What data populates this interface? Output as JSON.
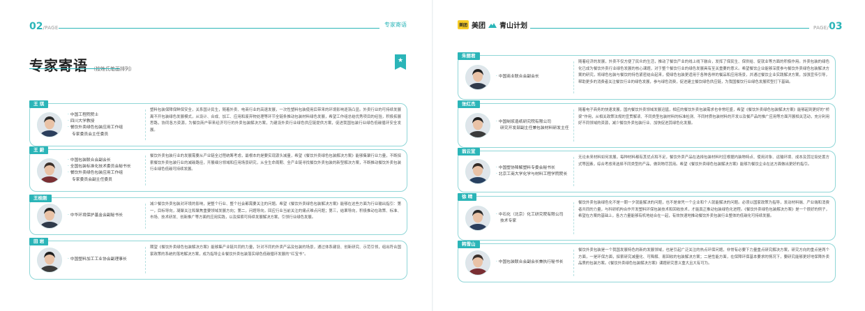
{
  "left_page": {
    "page_num": "02",
    "page_suffix": "/PAGE",
    "section": "专家寄语",
    "title": "专家寄语",
    "subtitle": "（按姓氏笔画排列）",
    "bookmark_icon": "star-icon",
    "experts": [
      {
        "name": "王 琪",
        "roles": [
          "中国工程院院士",
          "四川大学教授",
          "餐饮外卖绿色包装应用工作组",
          "专家委员会主任委员"
        ],
        "role_bullets": [
          true,
          true,
          true,
          false
        ],
        "quote": "塑料包装保障保鲜保安全，关系国计民生，随着外卖、电商行业的高速发展，一次性塑料包装使用后带来的环境影响逐渐凸显。外卖行业的可持续发展离不开包装绿色发展模式，从设计、合成、加工、应用和废弃物处理等环节全链条推动包装材料绿色发展，希望工作组总结优秀项目的经验，积极拓展思路，协同各方资源，为餐饮商户带来经济可行的外卖包装解决方案，为建设外卖行业绿色供应链提供方案，促进我国包装行业绿色低碳循环安全发展。"
      },
      {
        "name": "王 蔚",
        "roles": [
          "中国包装联合会副会长",
          "全国包装标准化技术委员会秘书长",
          "餐饮外卖绿色包装应用工作组",
          "专家委员会副主任委员"
        ],
        "role_bullets": [
          true,
          true,
          true,
          false
        ],
        "quote": "餐饮外卖包装行业的发展需要从产业链全过程统筹考虑，最根本的是要实现源头减量，希望《餐饮外卖绿色包装解决方案》能够集聚行业力量，不断探索餐饮外卖包装行业的减碳路径，开展细分领域和应用场景研究，从全生命周期、全产业链寻找餐饮外卖包装的新型解决方案，不断推动餐饮外卖包装行业绿色低碳可持续发展。"
      },
      {
        "name": "王桂刚",
        "roles": [
          "中华环境保护基金会副秘书长"
        ],
        "role_bullets": [
          true
        ],
        "quote": "减少餐饮外卖包装对环境的影响，是整个行业、整个社会都需要关注的问题。希望《餐饮外卖绿色包装解决方案》能够在这些方面为行业输出指引：第一，目标导向，凝聚关注和聚焦重要领域发展方向；第二，问题导向，回应行业当前关注的痛点难点问题；第三，结果导向，积极推动在政策、标准、市场、技术研发、创新推广等方面的应用实践，以及探索可持续发展解决方案，引领行业绿色发展。"
      },
      {
        "name": "田 岩",
        "roles": [
          "中国塑料加工工业协会副理事长"
        ],
        "role_bullets": [
          true
        ],
        "quote": "期望《餐饮外卖绿色包装解决方案》能够集产业链共同的力量，针对不同的外卖产品及包装的场景，通过体系建设、创新研究、示范引领，组出符合国家政策的系统的落地解决方案，成为指导企业餐饮外卖包装落实绿色低碳循环发展的“红宝书”。"
      }
    ]
  },
  "right_page": {
    "page_num": "03",
    "page_prefix": "PAGE/",
    "brand_meituan_box": "美团",
    "brand_meituan": "美团",
    "brand_qingshan": "青山计划",
    "experts": [
      {
        "name": "朱丽君",
        "roles": [
          "中国商业联合会副会长"
        ],
        "role_bullets": [
          true
        ],
        "quote": "随着经济的发展，外卖不仅方便了民众的生活，推动了餐饮产业的线上线下融合，发挥了保民生、保供给、促就业等方面的积极作用。外卖包装的绿色化已成为餐饮外卖行业绿色发展的核心课题，对于整个餐饮行业的绿色发展具有至关重要的意义。希望餐饮企业能够深度参与餐饮外卖绿色包装解决方案的研究，将绿色包装与餐饮的特色紧密结合起来，使绿色包装更适用于各种各样的餐品和应用场景，并通过餐饮企业实践解决方案，加强宣传引导，帮助更多的消费者关注餐饮行业的绿色发展，参与绿色消费，促进建立餐饮绿色供应链，为我国餐饮行业绿色发展转型打下基础。"
      },
      {
        "name": "张红杰",
        "roles": [
          "中国制浆造纸研究院有限公司",
          "研究开发部副主任兼包装材料研发主任"
        ],
        "role_bullets": [
          true,
          false
        ],
        "quote": "随着电子商务的快速发展，国内餐饮外卖领域发展迅猛，相应的餐饮外卖包装需求也非常旺盛，希望《餐饮外卖绿色包装解决方案》能够起到更好的“桥梁”作用，从相关政策法规的宣贯解读、不同类型包装材料的标准检测、不同材质包装材料的开发以及餐产品的推广应用等方面开展相关活动，充分利用好不同领域的资源，减少餐饮外卖包装行业、加快促进其绿色化发展。"
      },
      {
        "name": "翁云宣",
        "roles": [
          "中国塑协降解塑料专委会秘书长",
          "北京工商大学化学与材料工程学院院长"
        ],
        "role_bullets": [
          true,
          true
        ],
        "quote": "无论未来材料如何发展，每种材料都有其优点和不足，餐饮外卖产品在选择包装材料时应根据内装物特点、使用对象、运输环境、成本及其垃圾处置方式等因素，综合考虑来选择不同类型的产品，做到物尽其用。希望《餐饮外卖绿色包装解决方案》能够为餐饮企业在这方面做出更好的指引。"
      },
      {
        "name": "徐 晴",
        "roles": [
          "中石化（北京）化工研究院有限公司",
          "技术专家"
        ],
        "role_bullets": [
          true,
          false
        ],
        "quote": "餐饮外卖包装绿色化不是一朝一夕就能解决的问题，也不是单凭一个企业和个人就能解决的问题。必须以国家政策为指导，发动材料端、产业端和消费者共同的力量，与科研机构合作开发塑料环保包装技术和回收技术，才能真正推动包装绿色化进程。《餐饮外卖绿色包装解决方案》是一个很好的例子，希望在方案的基础上，各方力量能够有机地结合在一起，有效快速地推动餐饮外卖包装行业整体的低碳化可持续发展。"
      },
      {
        "name": "韩雪山",
        "roles": [
          "中国包装联合会副会长兼执行秘书长"
        ],
        "role_bullets": [
          true
        ],
        "quote": "餐饮外卖包装是一个我国发展特色的新的发展领域，也是引起广泛关注的热点环保问题，非常有必要下力量重点研究解决方案，研究方向的重点是两个方面，一是环保方面，探索研究减量化、可降解、易回收的包装解决方案；二是性能方面，在保障环保基本要求的情况下，要研究能够更好地保障外卖品质的包装方案。《餐饮外卖绿色包装解决方案》课题研究意义重大且大有可为。"
      }
    ]
  },
  "colors": {
    "accent": "#2bb5b8",
    "border": "#8fd6d7",
    "brand_yellow": "#f7cc26"
  }
}
